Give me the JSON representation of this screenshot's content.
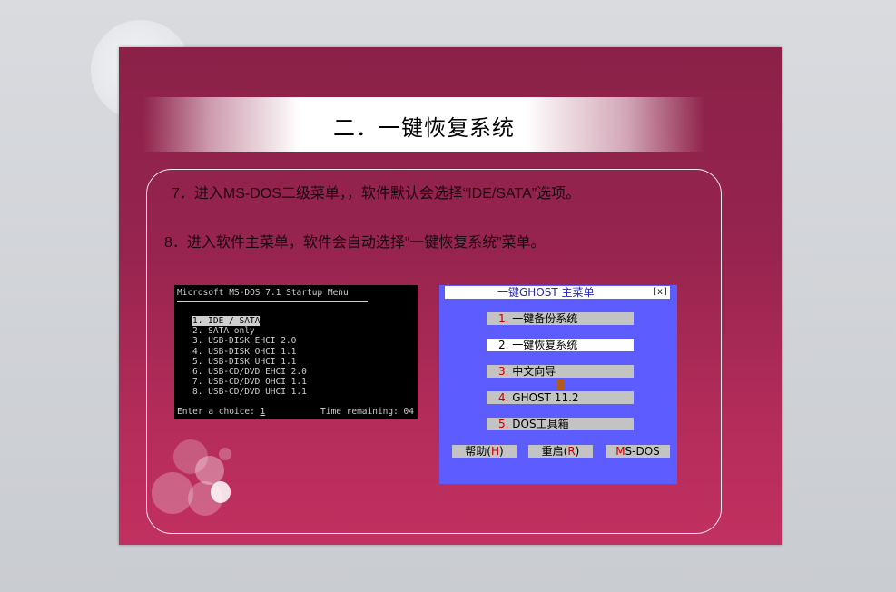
{
  "slide": {
    "title": "二．一键恢复系统",
    "line1": "7．进入MS-DOS二级菜单，，软件默认会选择“IDE/SATA”选项。",
    "line2": "8．进入软件主菜单，软件会自动选择“一键恢复系统”菜单。"
  },
  "dos_screen": {
    "header": "Microsoft MS-DOS 7.1 Startup Menu",
    "options": [
      "1. IDE / SATA",
      "2. SATA only",
      "3. USB-DISK EHCI 2.0",
      "4. USB-DISK OHCI 1.1",
      "5. USB-DISK UHCI 1.1",
      "6. USB-CD/DVD EHCI 2.0",
      "7. USB-CD/DVD OHCI 1.1",
      "8. USB-CD/DVD UHCI 1.1"
    ],
    "prompt": "Enter a choice: ",
    "choice": "1",
    "time_remaining": "Time remaining: 04"
  },
  "ghost_menu": {
    "title": "一键GHOST 主菜单",
    "close": "[x]",
    "items": [
      {
        "num": "1.",
        "label": "一键备份系统"
      },
      {
        "num": "2.",
        "label": "一键恢复系统"
      },
      {
        "num": "3.",
        "label": "中文向导"
      },
      {
        "num": "4.",
        "label": "GHOST 11.2"
      },
      {
        "num": "5.",
        "label": "DOS工具箱"
      }
    ],
    "buttons": [
      {
        "pre": "帮助(",
        "key": "H",
        "post": ")"
      },
      {
        "pre": "重启(",
        "key": "R",
        "post": ")"
      },
      {
        "pre": "",
        "key": "M",
        "post": "S-DOS"
      }
    ]
  },
  "colors": {
    "slide_top": "#8b2148",
    "slide_bottom": "#c13060",
    "ghost_bg": "#5c5cff",
    "hotkey": "#c00000"
  }
}
